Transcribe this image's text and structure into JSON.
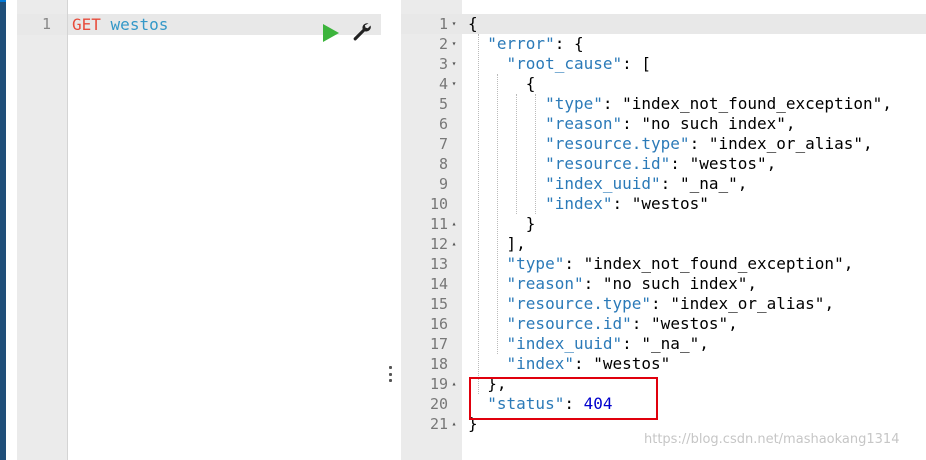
{
  "request_editor": {
    "line_number": "1",
    "method": "GET",
    "endpoint": "westos",
    "run_icon": "play-icon",
    "settings_icon": "wrench-icon"
  },
  "response": {
    "lines": [
      {
        "num": "1",
        "fold": "▾"
      },
      {
        "num": "2",
        "fold": "▾"
      },
      {
        "num": "3",
        "fold": "▾"
      },
      {
        "num": "4",
        "fold": "▾"
      },
      {
        "num": "5",
        "fold": ""
      },
      {
        "num": "6",
        "fold": ""
      },
      {
        "num": "7",
        "fold": ""
      },
      {
        "num": "8",
        "fold": ""
      },
      {
        "num": "9",
        "fold": ""
      },
      {
        "num": "10",
        "fold": ""
      },
      {
        "num": "11",
        "fold": "▴"
      },
      {
        "num": "12",
        "fold": "▴"
      },
      {
        "num": "13",
        "fold": ""
      },
      {
        "num": "14",
        "fold": ""
      },
      {
        "num": "15",
        "fold": ""
      },
      {
        "num": "16",
        "fold": ""
      },
      {
        "num": "17",
        "fold": ""
      },
      {
        "num": "18",
        "fold": ""
      },
      {
        "num": "19",
        "fold": "▴"
      },
      {
        "num": "20",
        "fold": ""
      },
      {
        "num": "21",
        "fold": "▴"
      }
    ],
    "code": [
      "{",
      "  \"error\": {",
      "    \"root_cause\": [",
      "      {",
      "        \"type\": \"index_not_found_exception\",",
      "        \"reason\": \"no such index\",",
      "        \"resource.type\": \"index_or_alias\",",
      "        \"resource.id\": \"westos\",",
      "        \"index_uuid\": \"_na_\",",
      "        \"index\": \"westos\"",
      "      }",
      "    ],",
      "    \"type\": \"index_not_found_exception\",",
      "    \"reason\": \"no such index\",",
      "    \"resource.type\": \"index_or_alias\",",
      "    \"resource.id\": \"westos\",",
      "    \"index_uuid\": \"_na_\",",
      "    \"index\": \"westos\"",
      "  },",
      "  \"status\": 404",
      "}"
    ]
  },
  "watermark": "https://blog.csdn.net/mashaokang1314",
  "colors": {
    "method": "#e74c3c",
    "endpoint": "#3498c8",
    "json_key": "#2b7ab8",
    "json_number": "#0000cd",
    "highlight": "#e0000d"
  }
}
